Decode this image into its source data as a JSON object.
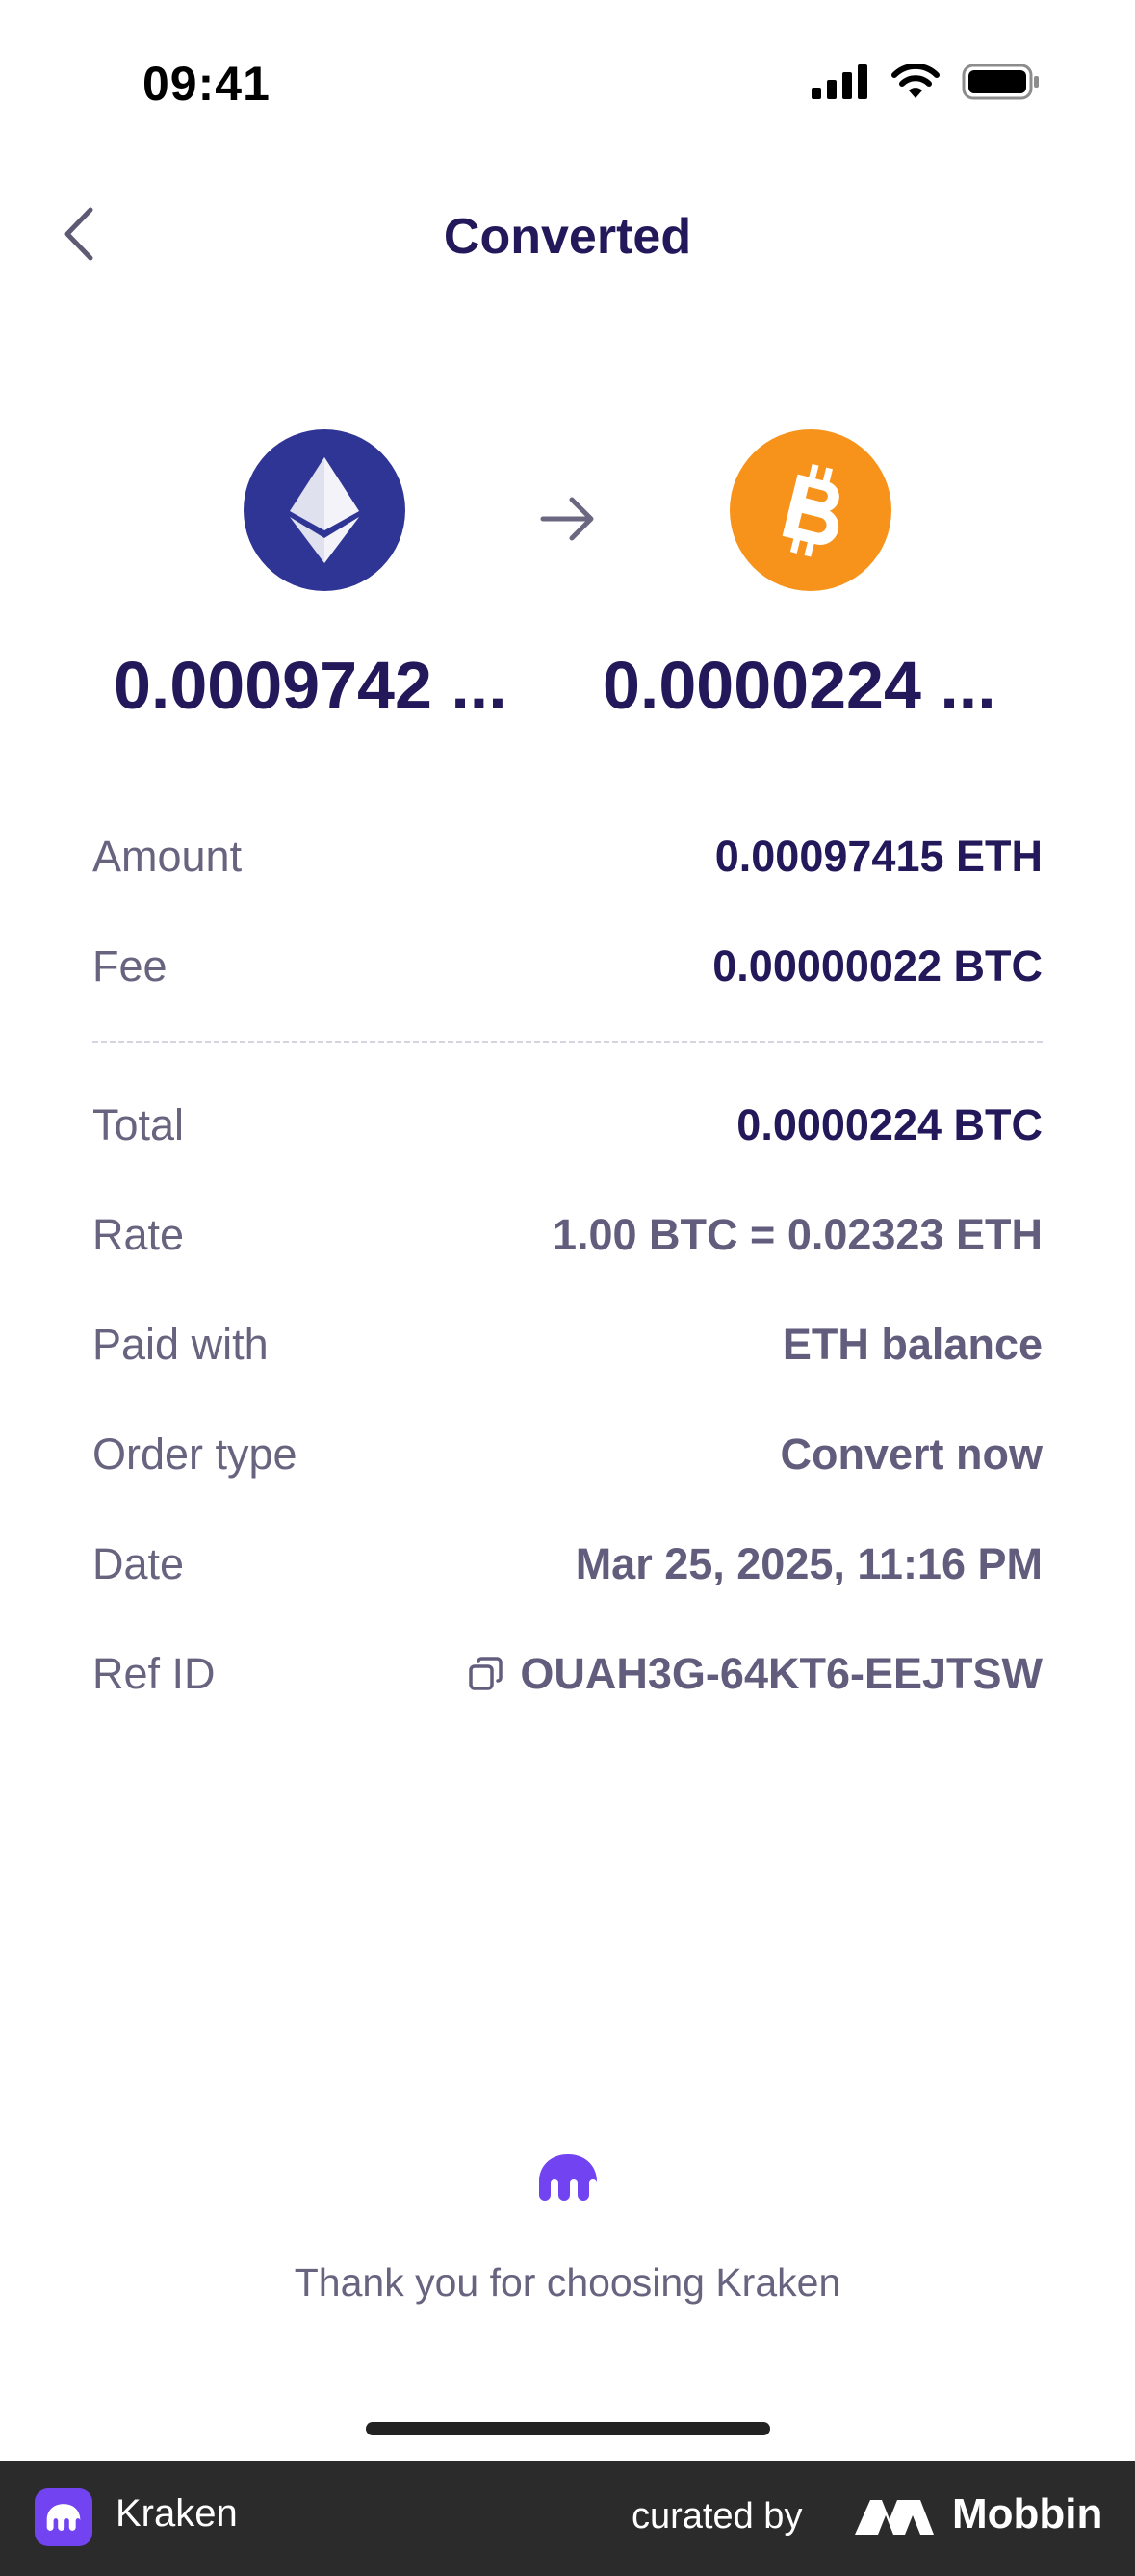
{
  "status_bar": {
    "time": "09:41"
  },
  "header": {
    "title": "Converted",
    "back_icon": "chevron-left-icon"
  },
  "conversion": {
    "from_icon": "ethereum-icon",
    "to_icon": "bitcoin-icon",
    "arrow_icon": "arrow-right-icon",
    "from_amount": "0.0009742 ...",
    "to_amount": "0.0000224 ..."
  },
  "details": {
    "amount": {
      "label": "Amount",
      "value": "0.00097415 ETH"
    },
    "fee": {
      "label": "Fee",
      "value": "0.00000022 BTC"
    },
    "total": {
      "label": "Total",
      "value": "0.0000224 BTC"
    },
    "rate": {
      "label": "Rate",
      "value": "1.00 BTC = 0.02323 ETH"
    },
    "paid_with": {
      "label": "Paid with",
      "value": "ETH balance"
    },
    "order_type": {
      "label": "Order type",
      "value": "Convert now"
    },
    "date": {
      "label": "Date",
      "value": "Mar 25, 2025, 11:16 PM"
    },
    "ref_id": {
      "label": "Ref ID",
      "value": "OUAH3G-64KT6-EEJTSW",
      "icon": "copy-icon"
    }
  },
  "footer_message": "Thank you for choosing Kraken",
  "attribution": {
    "app_name": "Kraken",
    "curated_by": "curated by",
    "brand": "Mobbin"
  },
  "colors": {
    "eth": "#2f3595",
    "btc": "#f7931a",
    "kraken_purple": "#7143f1",
    "title": "#23195a"
  }
}
